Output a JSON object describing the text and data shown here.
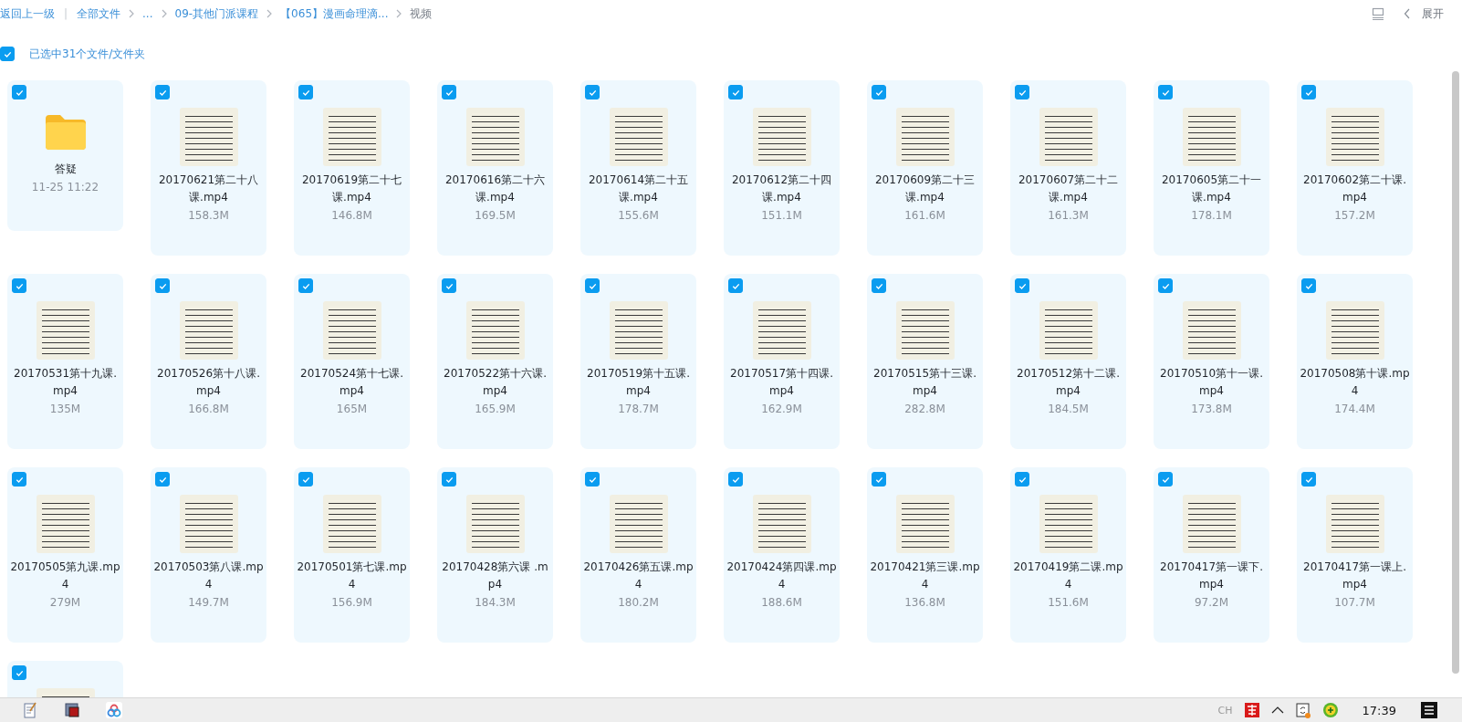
{
  "breadcrumb": {
    "back": "返回上一级",
    "separator": "|",
    "items": [
      {
        "label": "全部文件",
        "current": false
      },
      {
        "label": "...",
        "current": false
      },
      {
        "label": "09-其他门派课程",
        "current": false
      },
      {
        "label": "【065】漫画命理滴...",
        "current": false
      },
      {
        "label": "视频",
        "current": true
      }
    ]
  },
  "toolbar": {
    "expand_label": "展开"
  },
  "selection": {
    "checked": true,
    "label": "已选中31个文件/文件夹"
  },
  "items": [
    {
      "kind": "folder",
      "name": "答疑",
      "meta": "11-25 11:22",
      "checked": true
    },
    {
      "kind": "video",
      "name": "20170621第二十八课.mp4",
      "meta": "158.3M",
      "checked": true
    },
    {
      "kind": "video",
      "name": "20170619第二十七课.mp4",
      "meta": "146.8M",
      "checked": true
    },
    {
      "kind": "video",
      "name": "20170616第二十六课.mp4",
      "meta": "169.5M",
      "checked": true
    },
    {
      "kind": "video",
      "name": "20170614第二十五课.mp4",
      "meta": "155.6M",
      "checked": true
    },
    {
      "kind": "video",
      "name": "20170612第二十四课.mp4",
      "meta": "151.1M",
      "checked": true
    },
    {
      "kind": "video",
      "name": "20170609第二十三课.mp4",
      "meta": "161.6M",
      "checked": true
    },
    {
      "kind": "video",
      "name": "20170607第二十二课.mp4",
      "meta": "161.3M",
      "checked": true
    },
    {
      "kind": "video",
      "name": "20170605第二十一课.mp4",
      "meta": "178.1M",
      "checked": true
    },
    {
      "kind": "video",
      "name": "20170602第二十课.mp4",
      "meta": "157.2M",
      "checked": true
    },
    {
      "kind": "video",
      "name": "20170531第十九课.mp4",
      "meta": "135M",
      "checked": true
    },
    {
      "kind": "video",
      "name": "20170526第十八课.mp4",
      "meta": "166.8M",
      "checked": true
    },
    {
      "kind": "video",
      "name": "20170524第十七课.mp4",
      "meta": "165M",
      "checked": true
    },
    {
      "kind": "video",
      "name": "20170522第十六课.mp4",
      "meta": "165.9M",
      "checked": true
    },
    {
      "kind": "video",
      "name": "20170519第十五课.mp4",
      "meta": "178.7M",
      "checked": true
    },
    {
      "kind": "video",
      "name": "20170517第十四课.mp4",
      "meta": "162.9M",
      "checked": true
    },
    {
      "kind": "video",
      "name": "20170515第十三课.mp4",
      "meta": "282.8M",
      "checked": true
    },
    {
      "kind": "video",
      "name": "20170512第十二课.mp4",
      "meta": "184.5M",
      "checked": true
    },
    {
      "kind": "video",
      "name": "20170510第十一课.mp4",
      "meta": "173.8M",
      "checked": true
    },
    {
      "kind": "video",
      "name": "20170508第十课.mp4",
      "meta": "174.4M",
      "checked": true
    },
    {
      "kind": "video",
      "name": "20170505第九课.mp4",
      "meta": "279M",
      "checked": true
    },
    {
      "kind": "video",
      "name": "20170503第八课.mp4",
      "meta": "149.7M",
      "checked": true
    },
    {
      "kind": "video",
      "name": "20170501第七课.mp4",
      "meta": "156.9M",
      "checked": true
    },
    {
      "kind": "video",
      "name": "20170428第六课 .mp4",
      "meta": "184.3M",
      "checked": true
    },
    {
      "kind": "video",
      "name": "20170426第五课.mp4",
      "meta": "180.2M",
      "checked": true
    },
    {
      "kind": "video",
      "name": "20170424第四课.mp4",
      "meta": "188.6M",
      "checked": true
    },
    {
      "kind": "video",
      "name": "20170421第三课.mp4",
      "meta": "136.8M",
      "checked": true
    },
    {
      "kind": "video",
      "name": "20170419第二课.mp4",
      "meta": "151.6M",
      "checked": true
    },
    {
      "kind": "video",
      "name": "20170417第一课下.mp4",
      "meta": "97.2M",
      "checked": true
    },
    {
      "kind": "video",
      "name": "20170417第一课上.mp4",
      "meta": "107.7M",
      "checked": true
    },
    {
      "kind": "video",
      "checked": true
    }
  ],
  "taskbar": {
    "language": "CH",
    "time": "17:39"
  }
}
